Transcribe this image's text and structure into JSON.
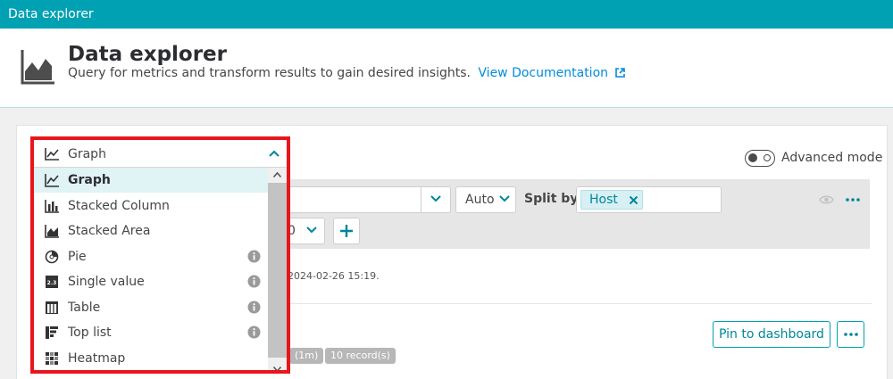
{
  "window": {
    "title": "Data explorer"
  },
  "header": {
    "title": "Data explorer",
    "subtitle": "Query for metrics and transform results to gain desired insights.",
    "doc_link": "View Documentation"
  },
  "advanced_mode": {
    "label": "Advanced mode",
    "enabled": false
  },
  "query": {
    "auto_label": "Auto",
    "split_by_label": "Split by",
    "split_by_chip": "Host",
    "resolution_value": "0"
  },
  "status": {
    "timestamp": "2024-02-26 15:19.",
    "badge_interval": "(1m)",
    "badge_records": "10 record(s)"
  },
  "actions": {
    "pin_label": "Pin to dashboard"
  },
  "visualization": {
    "selected": "Graph",
    "options": [
      {
        "label": "Graph",
        "icon": "line-chart-icon",
        "info": false,
        "selected": true
      },
      {
        "label": "Stacked Column",
        "icon": "stacked-column-icon",
        "info": false
      },
      {
        "label": "Stacked Area",
        "icon": "stacked-area-icon",
        "info": false
      },
      {
        "label": "Pie",
        "icon": "pie-icon",
        "info": true
      },
      {
        "label": "Single value",
        "icon": "single-value-icon",
        "info": true
      },
      {
        "label": "Table",
        "icon": "table-icon",
        "info": true
      },
      {
        "label": "Top list",
        "icon": "top-list-icon",
        "info": true
      },
      {
        "label": "Heatmap",
        "icon": "heatmap-icon",
        "info": false
      }
    ]
  },
  "colors": {
    "brand": "#00a1b2",
    "link": "#008cdb",
    "highlight_outline": "#e8161b",
    "selected_row": "#e0f3f5"
  }
}
